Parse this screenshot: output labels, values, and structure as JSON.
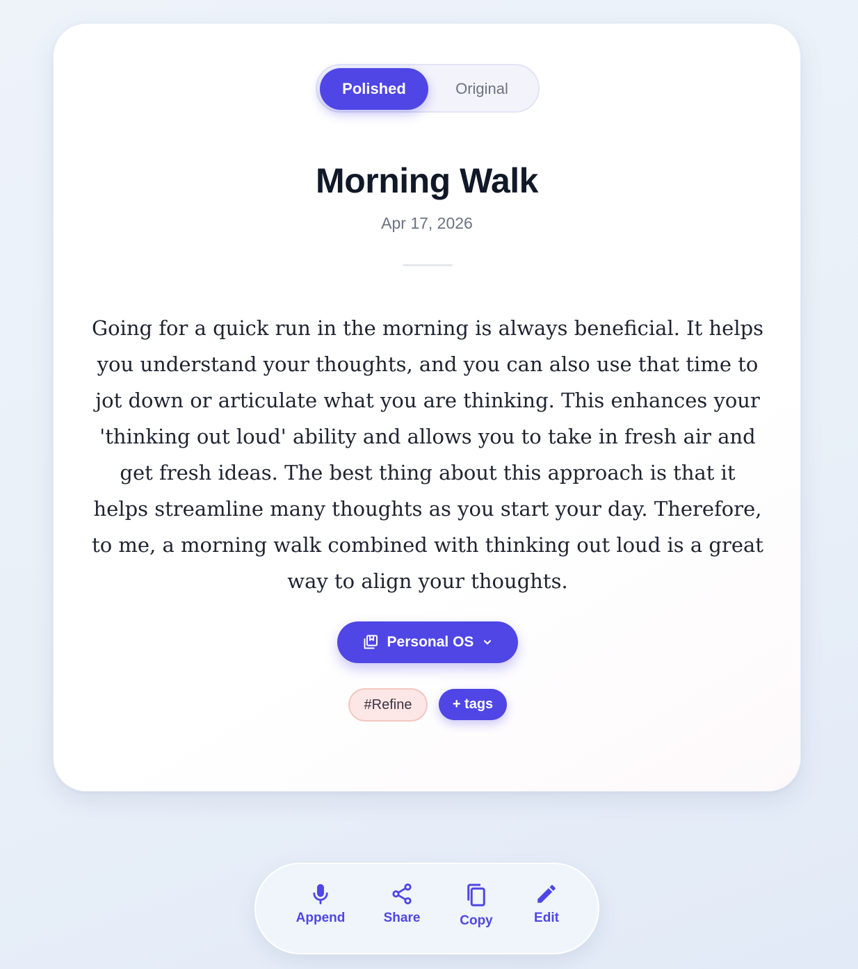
{
  "toggle": {
    "polished_label": "Polished",
    "original_label": "Original",
    "selected": "Polished"
  },
  "note": {
    "title": "Morning Walk",
    "date": "Apr 17, 2026",
    "body": "Going for a quick run in the morning is always beneficial. It helps you understand your thoughts, and you can also use that time to jot down or articulate what you are thinking. This enhances your 'thinking out loud' ability and allows you to take in fresh air and get fresh ideas. The best thing about this approach is that it helps streamline many thoughts as you start your day. Therefore, to me, a morning walk combined with thinking out loud is a great way to align your thoughts."
  },
  "collection": {
    "label": "Personal OS",
    "icon": "collection-icon",
    "dropdown_icon": "chevron-down-icon"
  },
  "tags": {
    "items": [
      "#Refine"
    ],
    "add_label": "+ tags"
  },
  "actions": [
    {
      "label": "Append",
      "icon": "microphone-icon"
    },
    {
      "label": "Share",
      "icon": "share-icon"
    },
    {
      "label": "Copy",
      "icon": "copy-icon"
    },
    {
      "label": "Edit",
      "icon": "pencil-icon"
    }
  ],
  "colors": {
    "accent": "#4f46e5",
    "title": "#111827",
    "muted": "#6b7280",
    "tag_bg": "#fde6e6",
    "tag_border": "#f4c7c1"
  }
}
